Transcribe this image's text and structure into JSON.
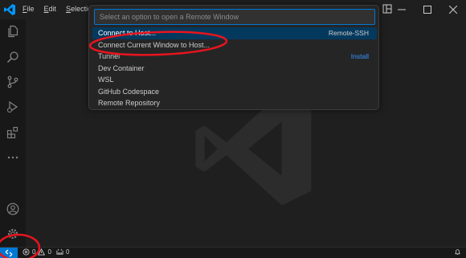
{
  "menu": [
    "File",
    "Edit",
    "Selection"
  ],
  "palette": {
    "placeholder": "Select an option to open a Remote Window",
    "items": [
      {
        "label": "Connect to Host...",
        "right": "Remote-SSH",
        "selected": true
      },
      {
        "label": "Connect Current Window to Host...",
        "right": "",
        "selected": false
      },
      {
        "label": "Tunnel",
        "right": "Install",
        "selected": false
      },
      {
        "label": "Dev Container",
        "right": "",
        "selected": false
      },
      {
        "label": "WSL",
        "right": "",
        "selected": false
      },
      {
        "label": "GitHub Codespace",
        "right": "",
        "selected": false
      },
      {
        "label": "Remote Repository",
        "right": "",
        "selected": false
      }
    ]
  },
  "status": {
    "errors": "0",
    "warnings": "0",
    "ports": "0"
  },
  "colors": {
    "accent": "#0078d4",
    "selection": "#04395e",
    "link": "#3794ff",
    "annotation": "#e8141e"
  },
  "activity_icons": [
    "explorer-icon",
    "search-icon",
    "source-control-icon",
    "run-debug-icon",
    "extensions-icon",
    "more-icon",
    "account-icon",
    "settings-icon"
  ]
}
